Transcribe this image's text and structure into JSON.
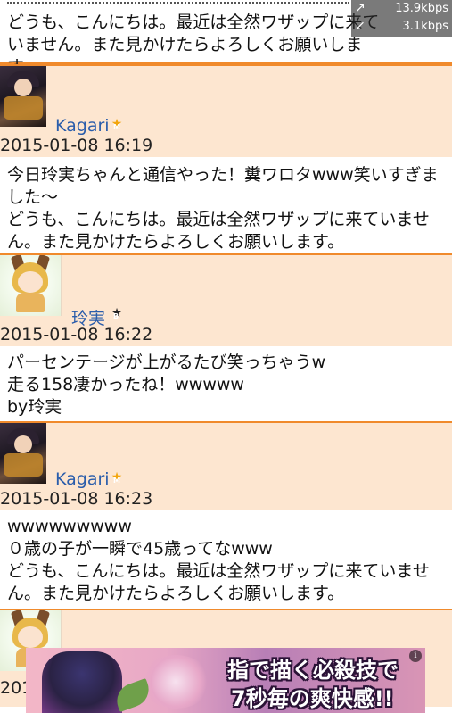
{
  "status": {
    "upload_speed": "13.9kbps",
    "download_speed": "3.1kbps"
  },
  "messages": [
    {
      "type": "body",
      "text": "どうも、こんにちは。最近は全然ワザップに来ていません。また見かけたらよろしくお願いします。"
    },
    {
      "type": "post",
      "user": "Kagari",
      "badge": "star-badge",
      "timestamp": "2015-01-08 16:19",
      "text": "今日玲実ちゃんと通信やった！糞ワロタwww笑いすぎました〜\nどうも、こんにちは。最近は全然ワザップに来ていません。また見かけたらよろしくお願いします。"
    },
    {
      "type": "post",
      "user": "玲実",
      "badge": "dark-badge",
      "timestamp": "2015-01-08 16:22",
      "text": "パーセンテージが上がるたび笑っちゃうw\n走る158凄かったね！wwwww\nby玲実"
    },
    {
      "type": "post",
      "user": "Kagari",
      "badge": "star-badge",
      "timestamp": "2015-01-08 16:23",
      "text": "wwwwwwwww\n０歳の子が一瞬で45歳ってなwww\nどうも、こんにちは。最近は全然ワザップに来ていません。また見かけたらよろしくお願いします。"
    },
    {
      "type": "post",
      "user": "",
      "timestamp": "201",
      "text": ""
    }
  ],
  "ad": {
    "line1": "指で描く必殺技で",
    "line2": "7秒毎の爽快感!!",
    "info_icon": "i"
  }
}
